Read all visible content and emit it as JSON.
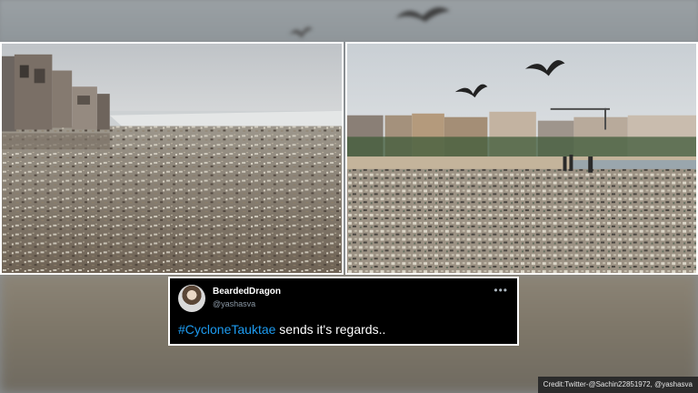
{
  "tweet": {
    "name": "BeardedDragon",
    "handle": "@yashasva",
    "hashtag": "#CycloneTauktae",
    "text_rest": " sends it's regards..",
    "more_icon": "more-horizontal-icon"
  },
  "credit": "Credit:Twitter-@Sachin22851972, @yashasva",
  "colors": {
    "tweet_bg": "#000000",
    "hashtag": "#1d9bf0",
    "handle": "#8b98a5"
  }
}
